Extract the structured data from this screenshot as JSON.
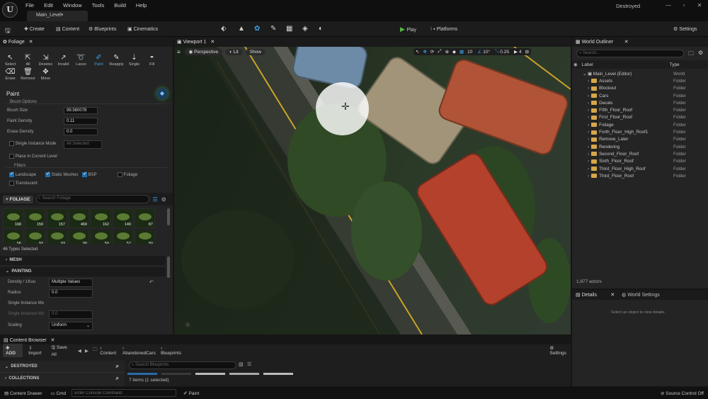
{
  "menu": [
    "File",
    "Edit",
    "Window",
    "Tools",
    "Build",
    "Help"
  ],
  "level_tab": "Main_Level•",
  "project_name": "Destroyed",
  "window_controls": [
    "—",
    "▫",
    "✕"
  ],
  "toolbar": {
    "create": "Create",
    "content": "Content",
    "blueprints": "Blueprints",
    "cinematics": "Cinematics",
    "play": "Play",
    "platforms": "Platforms",
    "settings": "Settings"
  },
  "foliage_panel": {
    "tab": "Foliage",
    "tools": [
      {
        "label": "Select",
        "icon": "pointer"
      },
      {
        "label": "All",
        "icon": "select-all"
      },
      {
        "label": "Deselec",
        "icon": "deselect"
      },
      {
        "label": "Invalid",
        "icon": "invalid"
      },
      {
        "label": "Lasso",
        "icon": "lasso"
      },
      {
        "label": "Paint",
        "icon": "paint-brush"
      },
      {
        "label": "Reapply",
        "icon": "reapply"
      },
      {
        "label": "Single",
        "icon": "single"
      },
      {
        "label": "Fill",
        "icon": "fill"
      }
    ],
    "tools2": [
      {
        "label": "Erase",
        "icon": "erase"
      },
      {
        "label": "Remove",
        "icon": "trash"
      },
      {
        "label": "Move",
        "icon": "move"
      }
    ],
    "mode_title": "Paint",
    "brush_options": "Brush Options",
    "brush_size_label": "Brush Size",
    "brush_size": "99.580078",
    "paint_density_label": "Paint Density",
    "paint_density": "0.11",
    "erase_density_label": "Erase Density",
    "erase_density": "0.0",
    "single_instance_label": "Single Instance Mode",
    "single_instance_value": "All Selected",
    "place_current_label": "Place in Current Level",
    "filters": "Filters",
    "filter_items": [
      "Landscape",
      "Static Meshes",
      "BSP",
      "Foliage",
      "Translucent"
    ],
    "add_foliage": "+ FOLIAGE",
    "search_placeholder": "Search Foliage",
    "thumbs_row1": [
      "168",
      "159",
      "157",
      "469",
      "162",
      "149",
      "87"
    ],
    "thumbs_row2": [
      "56",
      "93",
      "93",
      "90",
      "50",
      "57",
      "50"
    ],
    "types_selected": "46 Types Selected",
    "mesh": "MESH",
    "painting": "PAINTING",
    "density_label": "Density / 1Kuu",
    "density_value": "Multiple Values",
    "radius_label": "Radius",
    "radius_value": "0.0",
    "single_inst_label": "Single Instance Mo",
    "single_inst2_label": "Single Instance Mo",
    "single_inst2_value": "0.0",
    "scaling_label": "Scaling",
    "scaling_value": "Uniform"
  },
  "viewport": {
    "tab": "Viewport 1",
    "perspective": "Perspective",
    "lit": "Lit",
    "show": "Show",
    "grid": "10",
    "angle": "10°",
    "scale": "0.25",
    "cams": "4"
  },
  "outliner": {
    "tab": "World Outliner",
    "search_placeholder": "Search...",
    "col_label": "Label",
    "col_type": "Type",
    "root": {
      "name": "Main_Level (Editor)",
      "type": "World"
    },
    "items": [
      "Assets",
      "Blockout",
      "Cars",
      "Decals",
      "Fifth_Floor_Roof",
      "First_Floor_Roof",
      "Foliage",
      "Forth_Floor_High_Roof1",
      "Remove_Later",
      "Rendering",
      "Second_Floor_Roof",
      "Sixth_Floor_Roof",
      "Third_Floor_High_Roof",
      "Third_Floor_Roof"
    ],
    "item_type": "Folder",
    "actors": "1,977 actors"
  },
  "details": {
    "tab": "Details",
    "tab2": "World Settings",
    "empty": "Select an object to view details."
  },
  "content_browser": {
    "tab": "Content Browser",
    "add": "ADD",
    "import": "Import",
    "save_all": "Save All",
    "path": [
      "Content",
      "AbandonedCars",
      "Blueprints"
    ],
    "settings": "Settings",
    "destroyed": "DESTROYED",
    "collections": "COLLECTIONS",
    "search_placeholder": "Search Blueprints",
    "items_info": "7 items (1 selected)"
  },
  "statusbar": {
    "drawer": "Content Drawer",
    "cmd": "Cmd",
    "console_placeholder": "Enter Console Command",
    "paint": "Paint",
    "source": "Source Control Off"
  },
  "colors": {
    "accent": "#36a3e8",
    "play": "#5ab44a",
    "folder": "#d6a74a"
  }
}
